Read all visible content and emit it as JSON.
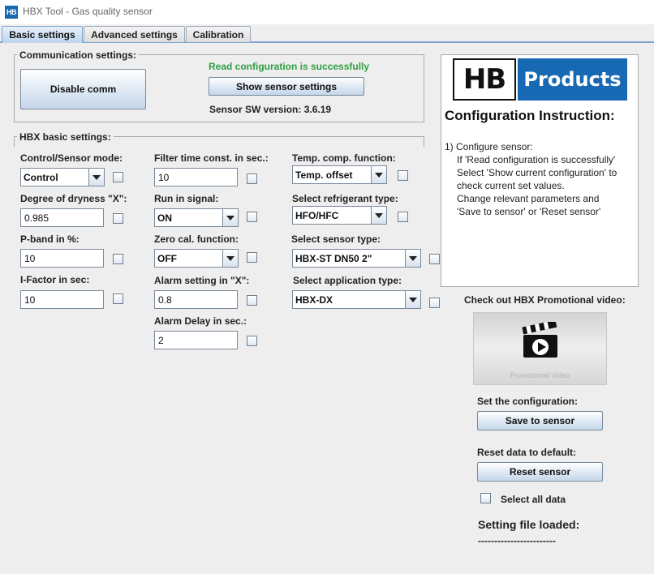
{
  "window": {
    "title": "HBX Tool - Gas quality sensor",
    "icon_text": "HB"
  },
  "tabs": [
    {
      "label": "Basic settings"
    },
    {
      "label": "Advanced settings"
    },
    {
      "label": "Calibration"
    }
  ],
  "communication": {
    "title": "Communication settings:",
    "disable_button": "Disable comm",
    "status": "Read configuration is successfully",
    "show_button": "Show sensor settings",
    "sw_version": "Sensor SW version: 3.6.19",
    "status_color": "#2ea043"
  },
  "basic": {
    "title": "HBX basic settings:",
    "control_mode": {
      "label": "Control/Sensor mode:",
      "value": "Control"
    },
    "dryness": {
      "label": "Degree of dryness \"X\":",
      "value": "0.985"
    },
    "pband": {
      "label": "P-band in %:",
      "value": "10"
    },
    "ifactor": {
      "label": "I-Factor in sec:",
      "value": "10"
    },
    "filter": {
      "label": "Filter time const. in sec.:",
      "value": "10"
    },
    "run_in": {
      "label": "Run in signal:",
      "value": "ON"
    },
    "zero_cal": {
      "label": "Zero cal. function:",
      "value": "OFF"
    },
    "alarm_setting": {
      "label": "Alarm setting in \"X\":",
      "value": "0.8"
    },
    "alarm_delay": {
      "label": "Alarm Delay in sec.:",
      "value": "2"
    },
    "temp_comp": {
      "label": "Temp. comp. function:",
      "value": "Temp. offset"
    },
    "refrigerant": {
      "label": "Select refrigerant type:",
      "value": "HFO/HFC"
    },
    "sensor_type": {
      "label": "Select sensor type:",
      "value": "HBX-ST DN50 2\""
    },
    "application": {
      "label": "Select application type:",
      "value": "HBX-DX"
    }
  },
  "instructions": {
    "logo_left": "HB",
    "logo_right": "Products",
    "title": "Configuration Instruction:",
    "lines": [
      "1) Configure sensor:",
      "If 'Read configuration is successfully'",
      "Select 'Show current configuration' to",
      "check current set values.",
      "Change relevant parameters and",
      "'Save to sensor' or 'Reset sensor'"
    ]
  },
  "video": {
    "heading": "Check out HBX Promotional video:",
    "caption": "Promotional Video"
  },
  "actions": {
    "set_label": "Set the configuration:",
    "save_button": "Save to sensor",
    "reset_label": "Reset data to default:",
    "reset_button": "Reset sensor",
    "select_all": "Select all data",
    "file_loaded_label": "Setting file loaded:",
    "file_loaded_value": "------------------------"
  },
  "colors": {
    "accent_blue": "#1769b4",
    "tab_border": "#7ea6cf"
  }
}
